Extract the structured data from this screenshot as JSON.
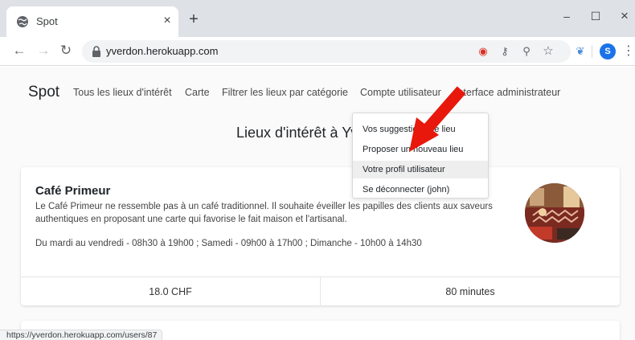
{
  "browser": {
    "tab_title": "Spot",
    "tab_close": "×",
    "new_tab": "+",
    "minimize": "–",
    "maximize": "☐",
    "close": "×",
    "back": "←",
    "forward": "→",
    "reload": "↻",
    "url": "yverdon.herokuapp.com",
    "profile_initial": "S",
    "menu": "⋮",
    "status_url": "https://yverdon.herokuapp.com/users/87"
  },
  "navbar": {
    "brand": "Spot",
    "links": [
      "Tous les lieux d'intérêt",
      "Carte",
      "Filtrer les lieux par catégorie",
      "Compte utilisateur",
      "Interface administrateur"
    ]
  },
  "dropdown": {
    "items": [
      "Vos suggestions de lieu",
      "Proposer un nouveau lieu",
      "Votre profil utilisateur",
      "Se déconnecter (john)"
    ]
  },
  "page": {
    "heading": "Lieux d'intérêt à Yverdon"
  },
  "place": {
    "name": "Café Primeur",
    "description": "Le Café Primeur ne ressemble pas à un café traditionnel. Il souhaite éveiller les papilles des clients aux saveurs authentiques en proposant une carte qui favorise le fait maison et l'artisanal.",
    "hours": "Du mardi au vendredi - 08h30 à 19h00 ; Samedi - 09h00 à 17h00 ; Dimanche - 10h00 à 14h30",
    "price": "18.0 CHF",
    "duration": "80 minutes"
  },
  "colors": {
    "annotation_arrow": "#e8180c",
    "tab_strip": "#dee1e6",
    "profile_avatar": "#1a73e8"
  }
}
